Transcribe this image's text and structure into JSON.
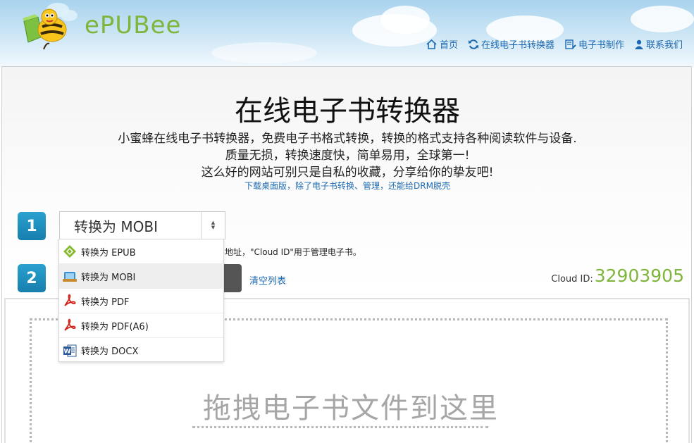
{
  "header": {
    "logo_text": "ePUBee",
    "nav": [
      {
        "label": "首页",
        "icon": "home-icon"
      },
      {
        "label": "在线电子书转换器",
        "icon": "refresh-icon"
      },
      {
        "label": "电子书制作",
        "icon": "book-edit-icon"
      },
      {
        "label": "联系我们",
        "icon": "user-icon"
      }
    ]
  },
  "main": {
    "title": "在线电子书转换器",
    "desc_line1": "小蜜蜂在线电子书转换器，免费电子书格式转换，转换的格式支持各种阅读软件与设备.",
    "desc_line2": "质量无损，转换速度快，简单易用，全球第一!",
    "desc_line3": "这么好的网站可别只是自私的收藏，分享给你的挚友吧!",
    "download_link": "下载桌面版，除了电子书转换、管理，还能给DRM脱壳",
    "step1": "1",
    "step2": "2",
    "select_label": "转换为 MOBI",
    "hint_text": "地址，\"Cloud ID\"用于管理电子书。",
    "clear_link": "清空列表",
    "cloud_id_label": "Cloud ID:",
    "cloud_id_value": "32903905",
    "drop_text": "拖拽电子书文件到这里"
  },
  "dropdown": {
    "options": [
      {
        "label": "转换为 EPUB",
        "icon": "epub-icon"
      },
      {
        "label": "转换为 MOBI",
        "icon": "mobi-icon",
        "selected": true
      },
      {
        "label": "转换为 PDF",
        "icon": "pdf-icon"
      },
      {
        "label": "转换为 PDF(A6)",
        "icon": "pdf-icon"
      },
      {
        "label": "转换为 DOCX",
        "icon": "word-icon"
      }
    ]
  },
  "colors": {
    "brand_green": "#7fb53b",
    "link_blue": "#1d69b0",
    "step_blue": "#1a8bbd"
  }
}
